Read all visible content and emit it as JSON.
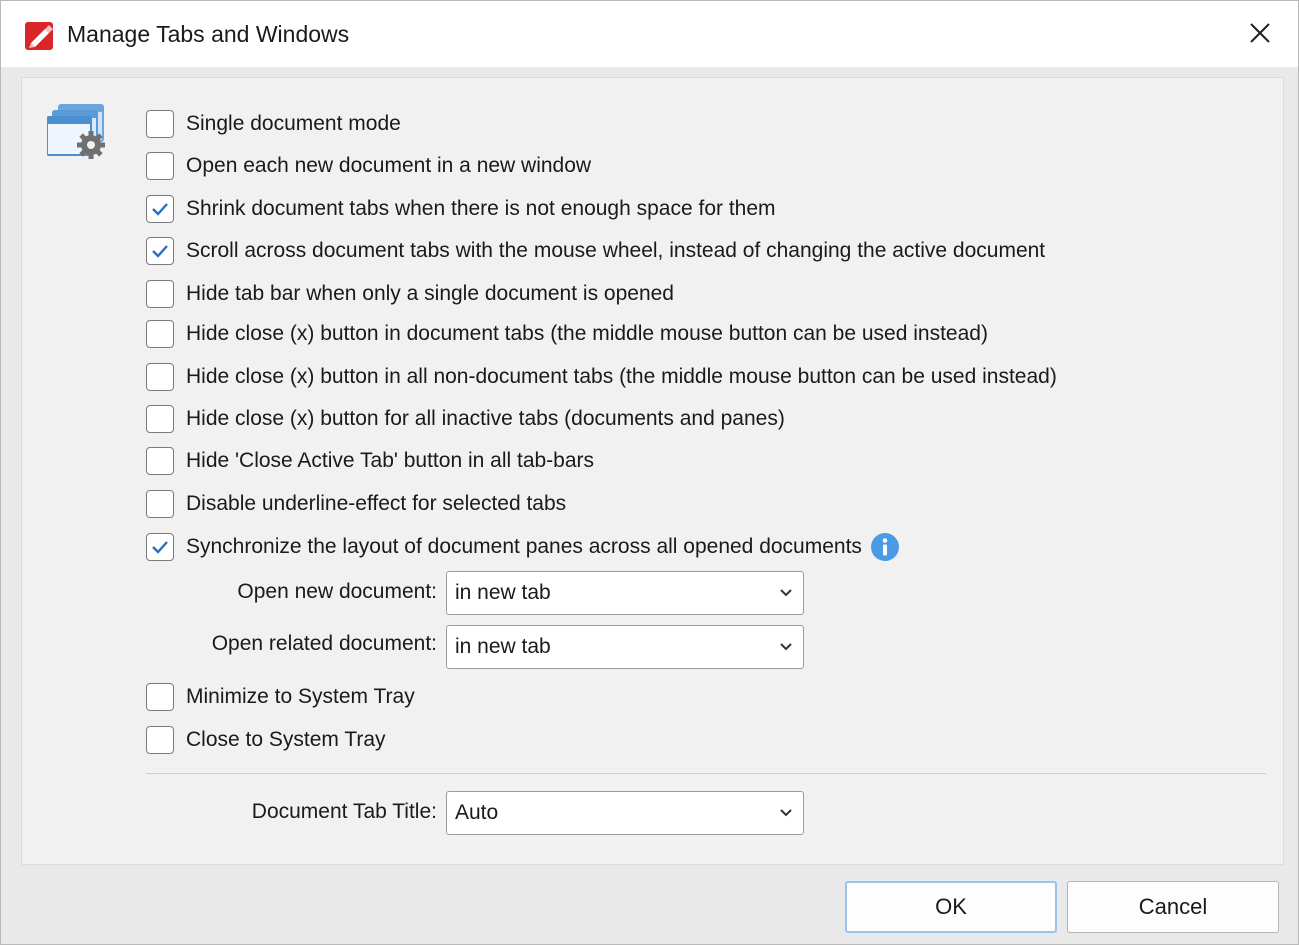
{
  "window": {
    "title": "Manage Tabs and Windows",
    "close_label": "×"
  },
  "options": [
    {
      "label": "Single document mode",
      "checked": false
    },
    {
      "label": "Open each new document in a new window",
      "checked": false
    },
    {
      "label": "Shrink document tabs when there is not enough space for them",
      "checked": true
    },
    {
      "label": "Scroll across document tabs with the mouse wheel, instead of changing the active document",
      "checked": true
    },
    {
      "label": "Hide tab bar when only a single document is opened",
      "checked": false
    },
    {
      "label": "Hide close (x) button in document tabs (the middle mouse button can be used instead)",
      "checked": false
    },
    {
      "label": "Hide close (x) button in all non-document tabs (the middle mouse button can be used instead)",
      "checked": false
    },
    {
      "label": "Hide close (x) button for all inactive tabs (documents and panes)",
      "checked": false
    },
    {
      "label": "Hide 'Close Active Tab' button in all tab-bars",
      "checked": false
    },
    {
      "label": "Disable underline-effect for selected tabs",
      "checked": false
    },
    {
      "label": "Synchronize the layout of document panes across all opened documents",
      "checked": true
    },
    {
      "label": "Minimize to System Tray",
      "checked": false
    },
    {
      "label": "Close to System Tray",
      "checked": false
    }
  ],
  "fields": {
    "open_new": {
      "label": "Open new document:",
      "value": "in new tab"
    },
    "open_related": {
      "label": "Open related document:",
      "value": "in new tab"
    },
    "tab_title": {
      "label": "Document Tab Title:",
      "value": "Auto"
    }
  },
  "buttons": {
    "ok": "OK",
    "cancel": "Cancel"
  },
  "colors": {
    "app_icon_red": "#d8262b",
    "checkmark_blue": "#2a6fc0",
    "info_blue": "#4a9be6",
    "ok_border": "#9ac2ec"
  },
  "icons": {
    "app": "pdf-editor-app-icon",
    "header": "windows-gear-icon",
    "info": "info-icon"
  }
}
